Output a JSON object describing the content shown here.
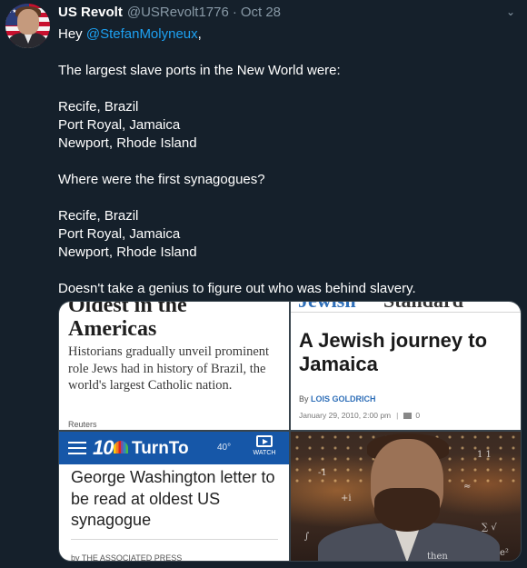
{
  "tweet": {
    "author_name": "US Revolt",
    "author_handle": "@USRevolt1776",
    "separator": "·",
    "timestamp": "Oct 28",
    "greeting_prefix": "Hey ",
    "mention": "@StefanMolyneux",
    "greeting_suffix": ",",
    "line_intro": "The largest slave ports in the New World were:",
    "ports": [
      "Recife, Brazil",
      "Port Royal, Jamaica",
      "Newport, Rhode Island"
    ],
    "question": "Where were the first synagogues?",
    "synagogues": [
      "Recife, Brazil",
      "Port Royal, Jamaica",
      "Newport, Rhode Island"
    ],
    "closing": "Doesn't take a genius to figure out who was behind slavery."
  },
  "icons": {
    "caret": "chevron-down-icon",
    "menu": "hamburger-menu-icon",
    "watch": "play-icon",
    "comment": "comment-icon"
  },
  "media": {
    "tile1": {
      "headline_cut": "Oldest in the",
      "headline": "Americas",
      "deck": "Historians gradually unveil prominent role Jews had in history of Brazil, the world's largest Catholic nation.",
      "credit": "Reuters"
    },
    "tile2": {
      "masthead_left": "Jewish",
      "masthead_right": "Standard",
      "title": "A Jewish journey to Jamaica",
      "by": "By ",
      "author": "LOIS GOLDRICH",
      "date": "January 29, 2010, 2:00 pm",
      "sep": "|",
      "comments": "0"
    },
    "tile3": {
      "logo_mark": "10",
      "brand": "TurnTo",
      "temp": "40°",
      "watch": "WATCH",
      "title": "George Washington letter to be read at oldest US synagogue",
      "byline": "by THE ASSOCIATED PRESS"
    },
    "tile4": {
      "equations": [
        "-1",
        "1 1",
        "+i",
        "≈",
        "∑ √",
        "then",
        "∫",
        "e²"
      ]
    }
  },
  "colors": {
    "background": "#15202b",
    "text": "#ffffff",
    "muted": "#8899a6",
    "link": "#1da1f2",
    "nbc_blue": "#1657a8"
  }
}
